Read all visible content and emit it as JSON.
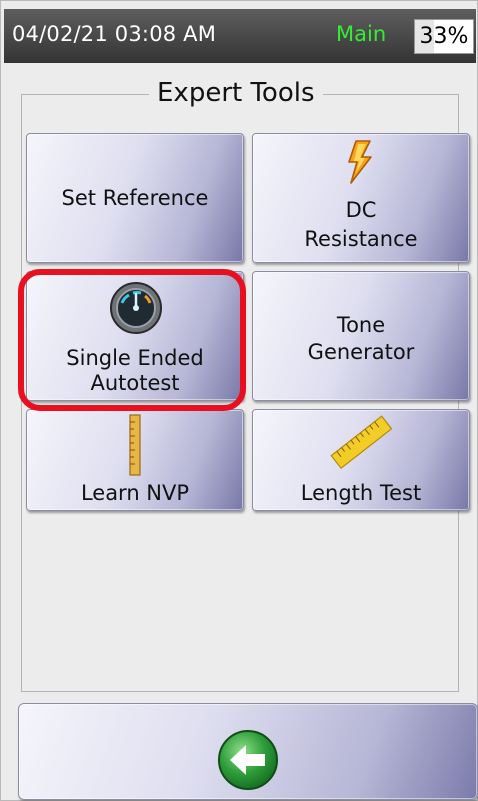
{
  "status_bar": {
    "datetime": "04/02/21 03:08 AM",
    "mode": "Main",
    "battery_percent_text": "33%",
    "battery_level": 0.33
  },
  "group": {
    "title": "Expert Tools"
  },
  "tools": [
    {
      "line1": "Set Reference",
      "line2": "",
      "icon": "none"
    },
    {
      "line1": "DC",
      "line2": "Resistance",
      "icon": "lightning-bolt-icon"
    },
    {
      "line1": "Single Ended",
      "line2": "Autotest",
      "icon": "gauge-icon",
      "highlighted": true
    },
    {
      "line1": "Tone",
      "line2": "Generator",
      "icon": "none"
    },
    {
      "line1": "Learn NVP",
      "line2": "",
      "icon": "vertical-ruler-icon"
    },
    {
      "line1": "Length Test",
      "line2": "",
      "icon": "tape-measure-ruler-icon"
    }
  ],
  "footer": {
    "back_icon": "back-arrow-icon"
  },
  "colors": {
    "status_bar": "#3c3c3c",
    "mode_text": "#33ee33",
    "highlight": "#e8101e",
    "button_accent": "#7878a8",
    "back_arrow": "#2e9a3a"
  }
}
